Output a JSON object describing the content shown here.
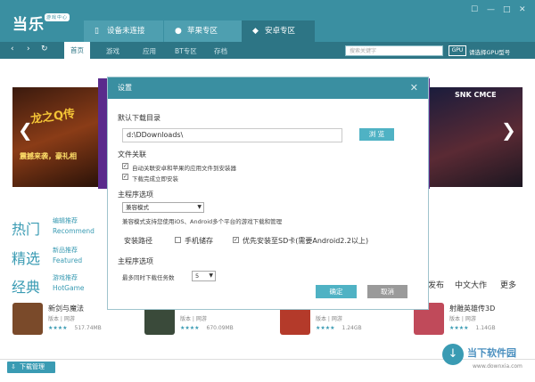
{
  "app": {
    "logo_text": "当乐",
    "logo_badge": "游戏中心"
  },
  "tabs": [
    {
      "label": "设备未连接",
      "icon": "phone-icon"
    },
    {
      "label": "苹果专区",
      "icon": "apple-icon"
    },
    {
      "label": "安卓专区",
      "icon": "android-icon"
    }
  ],
  "window_controls": {
    "skin": "☐",
    "min": "—",
    "max": "□",
    "close": "✕"
  },
  "nav": {
    "items": [
      "首页",
      "游戏",
      "应用",
      "BT专区",
      "存档"
    ],
    "active": "首页",
    "search_placeholder": "搜索关键字",
    "gpu_badge": "GPU",
    "gpu_label": "请选择GPU型号"
  },
  "banners": {
    "left_title": "龙之Q传",
    "left_sub": "震撼来袭，豪礼相",
    "right_title": "SNK CMCE"
  },
  "categories": [
    {
      "cn": "热门",
      "sub1": "编辑推荐",
      "sub2": "Recommend"
    },
    {
      "cn": "精选",
      "sub1": "新品推荐",
      "sub2": "Featured"
    },
    {
      "cn": "经典",
      "sub1": "游戏推荐",
      "sub2": "HotGame"
    }
  ],
  "right_links": [
    "发布",
    "中文大作",
    "更多"
  ],
  "games": [
    {
      "name": "新剑与魔法",
      "meta": "版本 | 网游",
      "stars": "★★★★",
      "size": "517.74MB",
      "color": "#7a4a2a"
    },
    {
      "name": "",
      "meta": "版本 | 网游",
      "stars": "★★★★",
      "size": "670.09MB",
      "color": "#3a4a3a"
    },
    {
      "name": "",
      "meta": "版本 | 网游",
      "stars": "★★★★",
      "size": "1.24GB",
      "color": "#b43a2a"
    },
    {
      "name": "射雕英雄传3D",
      "meta": "版本 | 网游",
      "stars": "★★★★",
      "size": "1.14GB",
      "color": "#c04a5a"
    }
  ],
  "bottom": {
    "download_mgr": "下载管理"
  },
  "watermark": {
    "text": "当下软件园",
    "url": "www.downxia.com"
  },
  "dialog": {
    "title": "设置",
    "close": "✕",
    "dl_dir_label": "默认下载目录",
    "dl_dir_value": "d:\\DDownloads\\",
    "browse": "浏 览",
    "file_assoc_label": "文件关联",
    "assoc_opt1": "自动关联安卓和苹果的应用文件到安装器",
    "assoc_opt2": "下载完成立即安装",
    "program_opt_label": "主程序选项",
    "mode_select": "兼容模式",
    "mode_desc": "兼容模式支持您使用iOS、Android多个平台的游戏下载和管理",
    "install_path_label": "安装路径",
    "install_phone": "手机储存",
    "install_sd": "优先安装至SD卡(需要Android2.2以上)",
    "program_opt_label2": "主程序选项",
    "max_tasks_label": "最多同时下载任务数",
    "max_tasks_value": "5",
    "ok": "确定",
    "cancel": "取消"
  }
}
